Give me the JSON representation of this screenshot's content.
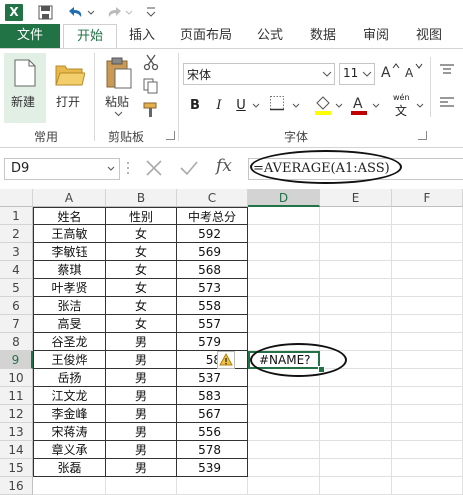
{
  "quick_access": {
    "app_icon": "excel-icon",
    "app_letter": "X",
    "items": [
      "save-icon",
      "undo-icon",
      "redo-icon",
      "customize-icon"
    ]
  },
  "tabs": {
    "file": "文件",
    "home": "开始",
    "insert": "插入",
    "layout": "页面布局",
    "formulas": "公式",
    "data": "数据",
    "review": "审阅",
    "view": "视图"
  },
  "ribbon": {
    "new_label": "新建",
    "open_label": "打开",
    "paste_label": "粘贴",
    "group_common": "常用",
    "group_clipboard": "剪贴板",
    "group_font": "字体",
    "font_name": "宋体",
    "font_size": "11",
    "bold": "B",
    "italic": "I",
    "underline": "U",
    "phonetic": "wén",
    "phonetic_sub": "文"
  },
  "formula_bar": {
    "name_box": "D9",
    "fx": "fx",
    "formula": "=AVERAGE(A1:ASS)"
  },
  "sheet": {
    "columns": [
      "A",
      "B",
      "C",
      "D",
      "E",
      "F"
    ],
    "rows": [
      {
        "n": "1",
        "a": "姓名",
        "b": "性别",
        "c": "中考总分"
      },
      {
        "n": "2",
        "a": "王高敏",
        "b": "女",
        "c": "592"
      },
      {
        "n": "3",
        "a": "李敏钰",
        "b": "女",
        "c": "569"
      },
      {
        "n": "4",
        "a": "蔡琪",
        "b": "女",
        "c": "568"
      },
      {
        "n": "5",
        "a": "叶孝贤",
        "b": "女",
        "c": "573"
      },
      {
        "n": "6",
        "a": "张洁",
        "b": "女",
        "c": "558"
      },
      {
        "n": "7",
        "a": "高旻",
        "b": "女",
        "c": "557"
      },
      {
        "n": "8",
        "a": "谷圣龙",
        "b": "男",
        "c": "579"
      },
      {
        "n": "9",
        "a": "王俊烨",
        "b": "男",
        "c": "58"
      },
      {
        "n": "10",
        "a": "岳扬",
        "b": "男",
        "c": "537"
      },
      {
        "n": "11",
        "a": "江文龙",
        "b": "男",
        "c": "583"
      },
      {
        "n": "12",
        "a": "李金峰",
        "b": "男",
        "c": "567"
      },
      {
        "n": "13",
        "a": "宋蒋涛",
        "b": "男",
        "c": "556"
      },
      {
        "n": "14",
        "a": "章义承",
        "b": "男",
        "c": "578"
      },
      {
        "n": "15",
        "a": "张磊",
        "b": "男",
        "c": "539"
      },
      {
        "n": "16",
        "a": "",
        "b": "",
        "c": ""
      }
    ],
    "d9_value": "#NAME?",
    "error_icon": "warning-icon"
  },
  "colors": {
    "excel_green": "#217346",
    "selected_fill": "#e1efe5",
    "font_color_red": "#c00000",
    "highlight_yellow": "#ffff00"
  }
}
